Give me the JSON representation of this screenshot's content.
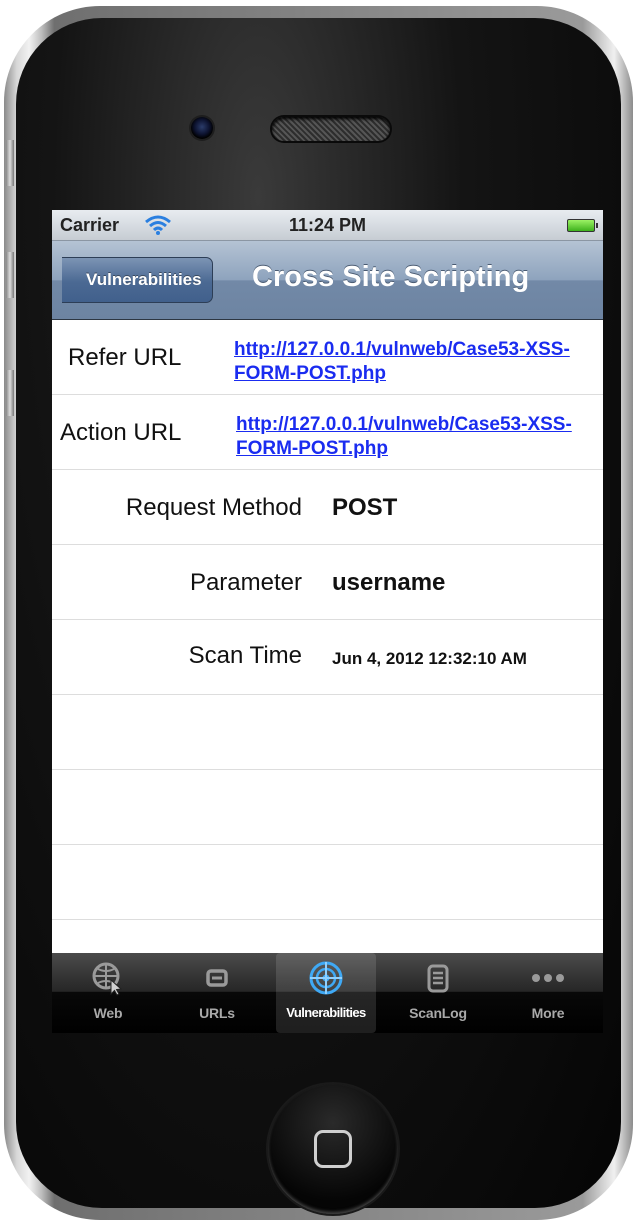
{
  "status_bar": {
    "carrier": "Carrier",
    "time": "11:24 PM"
  },
  "nav": {
    "back_label": "Vulnerabilities",
    "title": "Cross Site Scripting"
  },
  "details": {
    "refer_url_label": "Refer URL",
    "refer_url": "http://127.0.0.1/vulnweb/Case53-XSS-FORM-POST.php",
    "action_url_label": "Action URL",
    "action_url": "http://127.0.0.1/vulnweb/Case53-XSS-FORM-POST.php",
    "request_method_label": "Request Method",
    "request_method": "POST",
    "parameter_label": "Parameter",
    "parameter": "username",
    "scan_time_label": "Scan Time",
    "scan_time": "Jun 4, 2012 12:32:10 AM"
  },
  "tabs": [
    {
      "label": "Web",
      "icon": "globe-cursor-icon",
      "active": false
    },
    {
      "label": "URLs",
      "icon": "link-icon",
      "active": false
    },
    {
      "label": "Vulnerabilities",
      "icon": "target-icon",
      "active": true
    },
    {
      "label": "ScanLog",
      "icon": "document-list-icon",
      "active": false
    },
    {
      "label": "More",
      "icon": "more-dots-icon",
      "active": false
    }
  ]
}
